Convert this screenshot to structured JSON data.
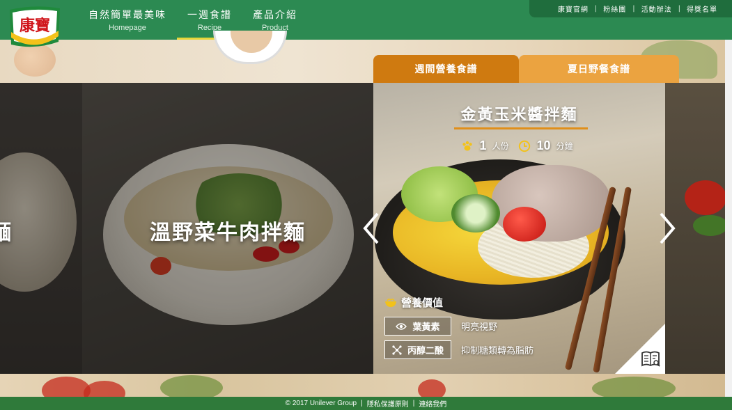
{
  "brand": {
    "logo_text": "康寶",
    "primary_color": "#2c8a52",
    "accent_color": "#cf7a10"
  },
  "nav": {
    "items": [
      {
        "zh": "自然簡單最美味",
        "en": "Homepage"
      },
      {
        "zh": "一週食譜",
        "en": "Recipe",
        "active": true
      },
      {
        "zh": "產品介紹",
        "en": "Product"
      }
    ]
  },
  "top_links": [
    "康寶官網",
    "粉絲團",
    "活動辦法",
    "得獎名單"
  ],
  "tabs": {
    "tab1": "週間營養食譜",
    "tab2": "夏日野餐食譜"
  },
  "carousel": {
    "left_title_fragment": "麵",
    "main_title": "溫野菜牛肉拌麵",
    "featured": {
      "title": "金黃玉米醬拌麵",
      "servings_num": "1",
      "servings_unit": "人份",
      "time_num": "10",
      "time_unit": "分鐘",
      "nutrition_heading": "營養價值",
      "nutrients": [
        {
          "name": "葉黃素",
          "icon": "eye-icon",
          "desc": "明亮視野"
        },
        {
          "name": "丙醇二酸",
          "icon": "molecule-icon",
          "desc": "抑制糖類轉為脂肪"
        }
      ]
    }
  },
  "footer": {
    "copyright": "© 2017 Unilever Group",
    "privacy": "隱私保護原則",
    "contact": "連絡我們"
  }
}
